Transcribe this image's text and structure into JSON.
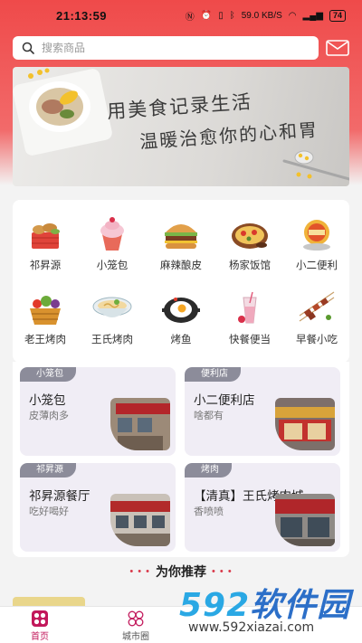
{
  "status_bar": {
    "time": "21:13:59",
    "network": "59.0 KB/S",
    "battery": "74"
  },
  "search": {
    "placeholder": "搜索商品"
  },
  "banner": {
    "line1": "用美食记录生活",
    "line2": "温暖治愈你的心和胃"
  },
  "categories": [
    {
      "label": "祁昇源",
      "icon": "bread-basket-icon"
    },
    {
      "label": "小笼包",
      "icon": "cupcake-icon"
    },
    {
      "label": "麻辣酿皮",
      "icon": "burger-icon"
    },
    {
      "label": "杨家饭馆",
      "icon": "pizza-icon"
    },
    {
      "label": "小二便利",
      "icon": "snack-bowl-icon"
    },
    {
      "label": "老王烤肉",
      "icon": "fruit-basket-icon"
    },
    {
      "label": "王氏烤肉",
      "icon": "noodle-bowl-icon"
    },
    {
      "label": "烤鱼",
      "icon": "fried-egg-pan-icon"
    },
    {
      "label": "快餐便当",
      "icon": "drink-cup-icon"
    },
    {
      "label": "早餐小吃",
      "icon": "skewers-icon"
    }
  ],
  "shops": [
    {
      "tag": "小笼包",
      "name": "小笼包",
      "desc": "皮薄肉多"
    },
    {
      "tag": "便利店",
      "name": "小二便利店",
      "desc": "啥都有"
    },
    {
      "tag": "祁昇源",
      "name": "祁昇源餐厅",
      "desc": "吃好喝好"
    },
    {
      "tag": "烤肉",
      "name": "【清真】王氏烤肉城",
      "desc": "香喷喷"
    }
  ],
  "recommend": {
    "dots": "• • •",
    "title": "为你推荐"
  },
  "nav": {
    "home_label": "首页",
    "city_label": "城市圈"
  },
  "colors": {
    "brand_red": "#ef4a4a",
    "nav_active": "#c2185b",
    "tag_gray": "#8c8c9a"
  },
  "watermark": {
    "brand_num": "592",
    "brand_cn": "软件园",
    "url": "www.592xiazai.com"
  }
}
